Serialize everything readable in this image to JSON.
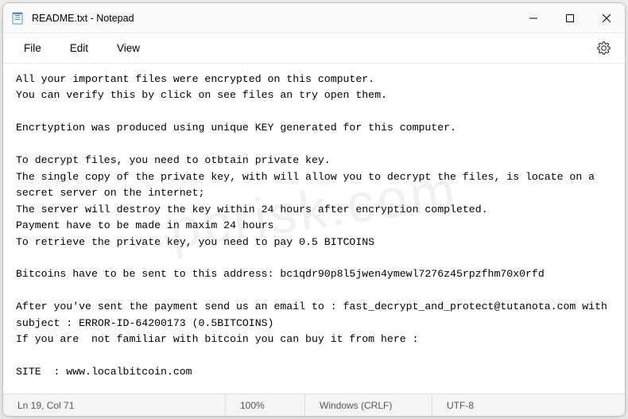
{
  "window": {
    "title": "README.txt - Notepad"
  },
  "menu": {
    "file": "File",
    "edit": "Edit",
    "view": "View"
  },
  "content": {
    "text": "All your important files were encrypted on this computer.\nYou can verify this by click on see files an try open them.\n\nEncrtyption was produced using unique KEY generated for this computer.\n\nTo decrypt files, you need to otbtain private key.\nThe single copy of the private key, with will allow you to decrypt the files, is locate on a secret server on the internet;\nThe server will destroy the key within 24 hours after encryption completed.\nPayment have to be made in maxim 24 hours\nTo retrieve the private key, you need to pay 0.5 BITCOINS\n\nBitcoins have to be sent to this address: bc1qdr90p8l5jwen4ymewl7276z45rpzfhm70x0rfd\n\nAfter you've sent the payment send us an email to : fast_decrypt_and_protect@tutanota.com with subject : ERROR-ID-64200173 (0.5BITCOINS)\nIf you are  not familiar with bitcoin you can buy it from here :\n\nSITE  : www.localbitcoin.com\n\nAfter we confirm the payment , we send the private key so you can decrypt your system."
  },
  "status": {
    "position": "Ln 19, Col 71",
    "zoom": "100%",
    "eol": "Windows (CRLF)",
    "encoding": "UTF-8"
  },
  "watermark": "pcrisk.com"
}
